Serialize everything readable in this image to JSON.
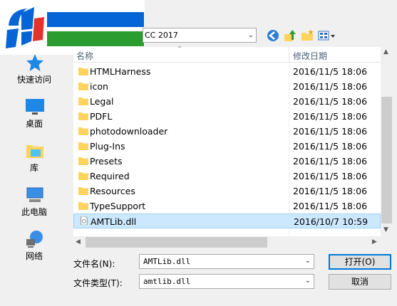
{
  "toolbar": {
    "look_in_value": "CC 2017",
    "back_icon": "back-arrow-icon",
    "up_icon": "up-folder-icon",
    "new_folder_icon": "new-folder-icon",
    "view_icon": "view-menu-icon"
  },
  "sidebar": {
    "items": [
      {
        "label": "快速访问",
        "icon": "star-icon"
      },
      {
        "label": "桌面",
        "icon": "desktop-icon"
      },
      {
        "label": "库",
        "icon": "library-icon"
      },
      {
        "label": "此电脑",
        "icon": "computer-icon"
      },
      {
        "label": "网络",
        "icon": "network-icon"
      }
    ]
  },
  "list": {
    "columns": {
      "name": "名称",
      "date": "修改日期"
    },
    "rows": [
      {
        "name": "HTMLHarness",
        "date": "2016/11/5 18:06",
        "type": "folder"
      },
      {
        "name": "icon",
        "date": "2016/11/5 18:06",
        "type": "folder"
      },
      {
        "name": "Legal",
        "date": "2016/11/5 18:06",
        "type": "folder"
      },
      {
        "name": "PDFL",
        "date": "2016/11/5 18:06",
        "type": "folder"
      },
      {
        "name": "photodownloader",
        "date": "2016/11/5 18:06",
        "type": "folder"
      },
      {
        "name": "Plug-Ins",
        "date": "2016/11/5 18:06",
        "type": "folder"
      },
      {
        "name": "Presets",
        "date": "2016/11/5 18:06",
        "type": "folder"
      },
      {
        "name": "Required",
        "date": "2016/11/5 18:06",
        "type": "folder"
      },
      {
        "name": "Resources",
        "date": "2016/11/5 18:06",
        "type": "folder"
      },
      {
        "name": "TypeSupport",
        "date": "2016/11/5 18:06",
        "type": "folder"
      },
      {
        "name": "AMTLib.dll",
        "date": "2016/10/7 10:59",
        "type": "file",
        "selected": true
      }
    ]
  },
  "footer": {
    "filename_label": "文件名(N):",
    "filename_value": "AMTLib.dll",
    "filetype_label": "文件类型(T):",
    "filetype_value": "amtlib.dll",
    "open_button": "打开(O)",
    "cancel_button": "取消"
  },
  "colors": {
    "accent": "#0078d7",
    "selection": "#cce8ff",
    "folder": "#ffd35c",
    "logo_blue": "#0565d6",
    "logo_green": "#2b9c30"
  }
}
